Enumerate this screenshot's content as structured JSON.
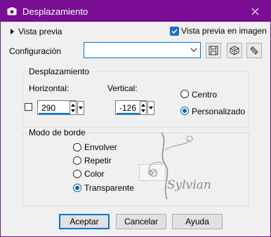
{
  "window": {
    "title": "Desplazamiento"
  },
  "header": {
    "preview_label": "Vista previa",
    "preview_in_image_label": "Vista previa en imagen",
    "preview_in_image_checked": true
  },
  "config": {
    "label": "Configuración",
    "value": ""
  },
  "displacement": {
    "group_label": "Desplazamiento",
    "horizontal_label": "Horizontal:",
    "horizontal_value": "290",
    "vertical_label": "Vertical:",
    "vertical_value": "-126",
    "radio_center": "Centro",
    "radio_custom": "Personalizado",
    "selected": "Personalizado"
  },
  "edge_mode": {
    "group_label": "Modo de borde",
    "options": [
      "Envolver",
      "Repetir",
      "Color",
      "Transparente"
    ],
    "selected": "Transparente"
  },
  "watermark": {
    "text": "Sylviane"
  },
  "buttons": {
    "ok": "Aceptar",
    "cancel": "Cancelar",
    "help": "Ayuda"
  },
  "colors": {
    "titlebar": "#7a0d93",
    "accent": "#0078d4",
    "dialog_bg": "#f0f0f0"
  }
}
